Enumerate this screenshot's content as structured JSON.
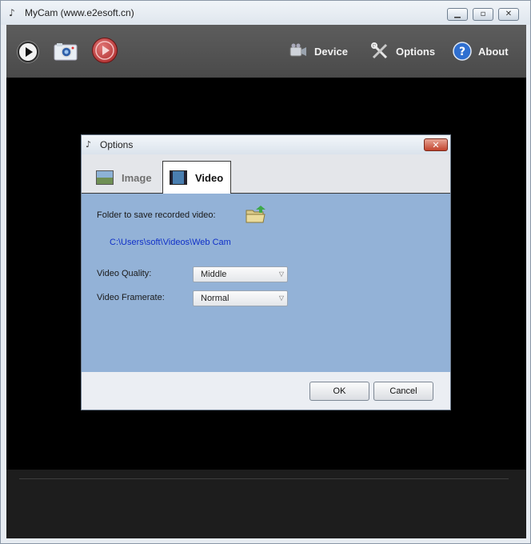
{
  "window": {
    "title": "MyCam (www.e2esoft.cn)"
  },
  "toolbar": {
    "device_label": "Device",
    "options_label": "Options",
    "about_label": "About"
  },
  "dialog": {
    "title": "Options",
    "tabs": [
      {
        "label": "Image",
        "active": false
      },
      {
        "label": "Video",
        "active": true
      }
    ],
    "folder_label": "Folder to save recorded video:",
    "folder_path": "C:\\Users\\soft\\Videos\\Web Cam",
    "quality_label": "Video Quality:",
    "quality_value": "Middle",
    "framerate_label": "Video Framerate:",
    "framerate_value": "Normal",
    "ok_label": "OK",
    "cancel_label": "Cancel"
  },
  "colors": {
    "content_bg": "#93b2d7",
    "path_text": "#1030c8",
    "record_button": "#c23a3a",
    "toolbar_bg": "#555555"
  }
}
